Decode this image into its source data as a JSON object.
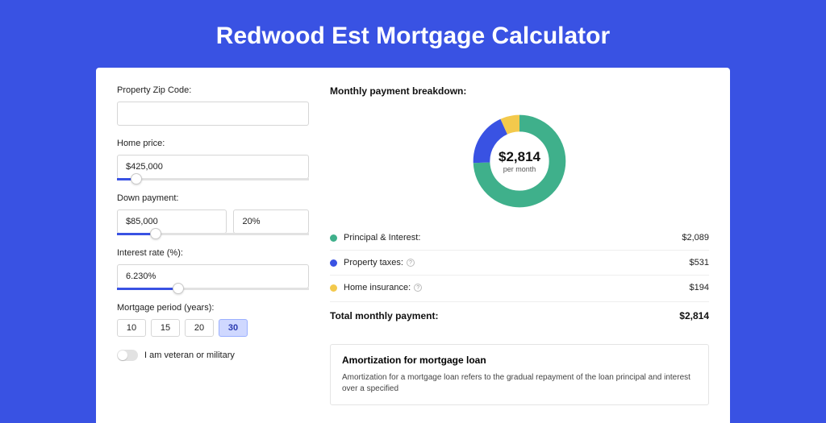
{
  "title": "Redwood Est Mortgage Calculator",
  "form": {
    "zip": {
      "label": "Property Zip Code:",
      "value": ""
    },
    "price": {
      "label": "Home price:",
      "value": "$425,000",
      "slider_pct": 10
    },
    "down": {
      "label": "Down payment:",
      "amount": "$85,000",
      "percent": "20%",
      "slider_pct": 20
    },
    "rate": {
      "label": "Interest rate (%):",
      "value": "6.230%",
      "slider_pct": 32
    },
    "period": {
      "label": "Mortgage period (years):",
      "options": [
        "10",
        "15",
        "20",
        "30"
      ],
      "selected": "30"
    },
    "veteran": {
      "label": "I am veteran or military"
    }
  },
  "breakdown": {
    "title": "Monthly payment breakdown:",
    "center_value": "$2,814",
    "center_sub": "per month",
    "items": [
      {
        "color": "green",
        "label": "Principal & Interest:",
        "value": "$2,089",
        "help": false
      },
      {
        "color": "blue",
        "label": "Property taxes:",
        "value": "$531",
        "help": true
      },
      {
        "color": "yellow",
        "label": "Home insurance:",
        "value": "$194",
        "help": true
      }
    ],
    "total_label": "Total monthly payment:",
    "total_value": "$2,814"
  },
  "amort": {
    "heading": "Amortization for mortgage loan",
    "text": "Amortization for a mortgage loan refers to the gradual repayment of the loan principal and interest over a specified"
  },
  "chart_data": {
    "type": "pie",
    "title": "Monthly payment breakdown",
    "series": [
      {
        "name": "Principal & Interest",
        "value": 2089,
        "color": "#3fb08b"
      },
      {
        "name": "Property taxes",
        "value": 531,
        "color": "#3952e3"
      },
      {
        "name": "Home insurance",
        "value": 194,
        "color": "#f3c94c"
      }
    ],
    "total": 2814,
    "unit": "USD per month"
  }
}
